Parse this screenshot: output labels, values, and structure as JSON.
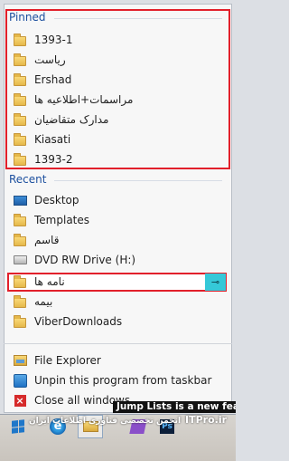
{
  "jumplist": {
    "pinned_header": "Pinned",
    "recent_header": "Recent",
    "pinned_items": [
      {
        "label": "1393-1",
        "icon": "folder-icon"
      },
      {
        "label": "ریاست",
        "icon": "folder-icon"
      },
      {
        "label": "Ershad",
        "icon": "folder-icon"
      },
      {
        "label": "مراسمات+اطلاعیه ها",
        "icon": "folder-icon"
      },
      {
        "label": "مدارک متقاضیان",
        "icon": "folder-icon"
      },
      {
        "label": "Kiasati",
        "icon": "folder-icon"
      },
      {
        "label": "1393-2",
        "icon": "folder-icon"
      }
    ],
    "recent_items": [
      {
        "label": "Desktop",
        "icon": "desktop-icon"
      },
      {
        "label": "Templates",
        "icon": "folder-icon"
      },
      {
        "label": "قاسم",
        "icon": "folder-icon"
      },
      {
        "label": "DVD RW Drive (H:)",
        "icon": "dvd-drive-icon"
      },
      {
        "label": "نامه ها",
        "icon": "folder-icon"
      },
      {
        "label": "بیمه",
        "icon": "folder-icon"
      },
      {
        "label": "ViberDownloads",
        "icon": "folder-icon"
      }
    ],
    "tasks": [
      {
        "label": "File Explorer",
        "icon": "file-explorer-icon"
      },
      {
        "label": "Unpin this program from taskbar",
        "icon": "unpin-icon"
      },
      {
        "label": "Close all windows",
        "icon": "close-icon"
      }
    ]
  },
  "tooltip": "Jump Lists is a new feat",
  "watermark": {
    "site": "ITPro.ir",
    "persian": "انجمن تخصصی فناوری اطلاعات ایران"
  },
  "taskbar": {
    "buttons": [
      "start-button-icon",
      "internet-explorer-icon",
      "file-explorer-icon",
      "visual-studio-icon",
      "photoshop-icon"
    ]
  },
  "colors": {
    "section_header": "#1c4f9e",
    "highlight_border": "#e2202b",
    "pin_button": "#35c8d8"
  }
}
